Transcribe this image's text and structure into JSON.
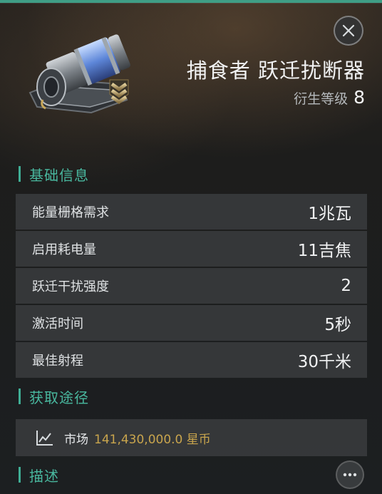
{
  "header": {
    "title": "捕食者 跃迁扰断器",
    "tier_label": "衍生等级",
    "tier_value": "8",
    "item_icon": "warp-disruptor-module-icon",
    "close_icon": "close-icon"
  },
  "basic_info": {
    "section_title": "基础信息",
    "rows": [
      {
        "label": "能量栅格需求",
        "value": "1兆瓦"
      },
      {
        "label": "启用耗电量",
        "value": "11吉焦"
      },
      {
        "label": "跃迁干扰强度",
        "value": "2"
      },
      {
        "label": "激活时间",
        "value": "5秒"
      },
      {
        "label": "最佳射程",
        "value": "30千米"
      }
    ]
  },
  "acquisition": {
    "section_title": "获取途径",
    "source_icon": "market-chart-icon",
    "source_name": "市场",
    "price": "141,430,000.0 星币"
  },
  "description": {
    "section_title": "描述",
    "more_icon": "more-icon"
  },
  "colors": {
    "accent": "#3fae95",
    "price": "#c9a54d"
  }
}
